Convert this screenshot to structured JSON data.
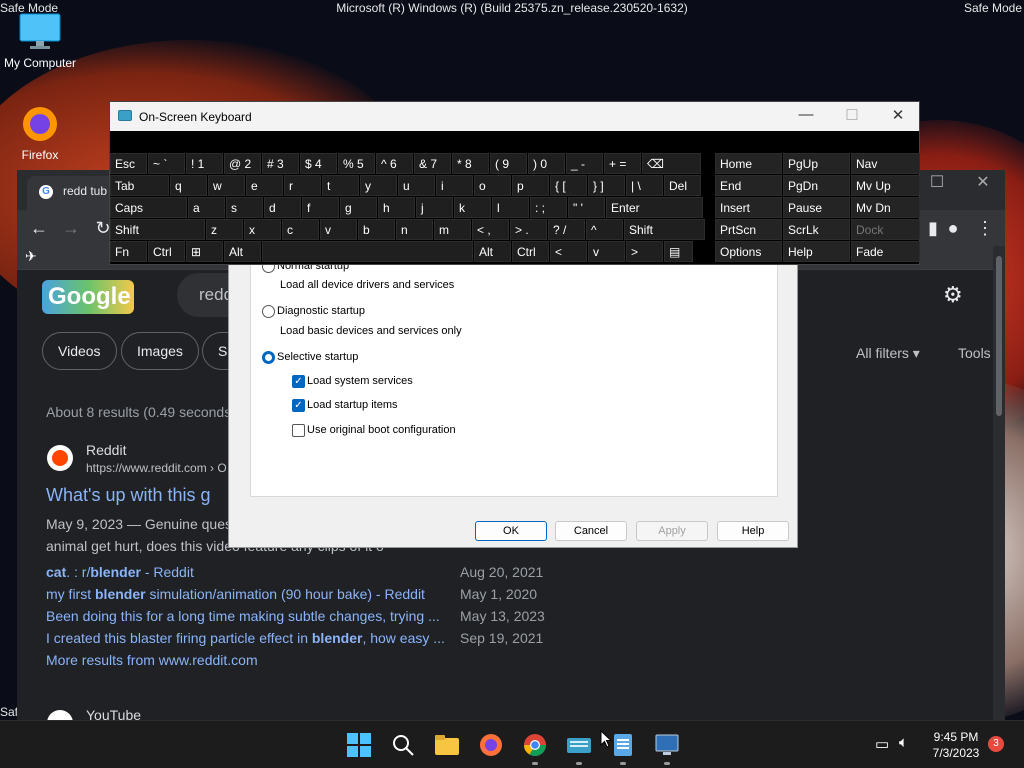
{
  "desktop": {
    "safe_mode_label": "Safe Mode",
    "title_bar": "Microsoft (R) Windows (R) (Build 25375.zn_release.230520-1632)",
    "icons": {
      "my_computer": "My Computer",
      "firefox": "Firefox"
    }
  },
  "browser": {
    "tab_title": "redd tub",
    "search_query": "redd",
    "chips": [
      "Videos",
      "Images",
      "S"
    ],
    "all_filters": "All filters",
    "tools": "Tools",
    "result_stats": "About 8 results (0.49 seconds",
    "result": {
      "site_name": "Reddit",
      "url": "https://www.reddit.com › O",
      "title": "What's up with this g",
      "snippet_line1": "May 9, 2023 — Genuine ques",
      "snippet_line2": "animal get hurt, does this video feature any clips of it o",
      "sublinks": [
        {
          "pre": "cat",
          "mid": ". : r/",
          "bold": "blender",
          "post": " - Reddit",
          "date": "Aug 20, 2021"
        },
        {
          "pre": "my first ",
          "mid": "",
          "bold": "blender",
          "post": " simulation/animation (90 hour bake) - Reddit",
          "date": "May 1, 2020"
        },
        {
          "pre": "Been doing this for a long time making subtle changes, trying ...",
          "mid": "",
          "bold": "",
          "post": "",
          "date": "May 13, 2023"
        },
        {
          "pre": "I created this blaster firing particle effect in ",
          "mid": "",
          "bold": "blender",
          "post": ", how easy ...",
          "date": "Sep 19, 2021"
        }
      ],
      "more_results": "More results from www.reddit.com"
    },
    "next_site": "YouTube"
  },
  "sysconfig": {
    "normal_startup": "Normal startup",
    "normal_desc": "Load all device drivers and services",
    "diagnostic_startup": "Diagnostic startup",
    "diagnostic_desc": "Load basic devices and services only",
    "selective_startup": "Selective startup",
    "load_system_services": "Load system services",
    "load_startup_items": "Load startup items",
    "use_original_boot": "Use original boot configuration",
    "buttons": {
      "ok": "OK",
      "cancel": "Cancel",
      "apply": "Apply",
      "help": "Help"
    }
  },
  "osk": {
    "title": "On-Screen Keyboard",
    "rows": [
      [
        "Esc",
        "~ `",
        "! 1",
        "@ 2",
        "# 3",
        "$ 4",
        "% 5",
        "^ 6",
        "& 7",
        "* 8",
        "( 9",
        ") 0",
        "_ -",
        "+ =",
        "⌫"
      ],
      [
        "Tab",
        "q",
        "w",
        "e",
        "r",
        "t",
        "y",
        "u",
        "i",
        "o",
        "p",
        "{ [",
        "} ]",
        "| \\",
        "Del"
      ],
      [
        "Caps",
        "a",
        "s",
        "d",
        "f",
        "g",
        "h",
        "j",
        "k",
        "l",
        ": ;",
        "\" '",
        "Enter"
      ],
      [
        "Shift",
        "z",
        "x",
        "c",
        "v",
        "b",
        "n",
        "m",
        "< ,",
        "> .",
        "? /",
        "^",
        "Shift"
      ],
      [
        "Fn",
        "Ctrl",
        "⊞",
        "Alt",
        "",
        "Alt",
        "Ctrl",
        "<",
        "v",
        ">",
        "▤"
      ]
    ],
    "nav_rows": [
      [
        "Home",
        "PgUp",
        "Nav"
      ],
      [
        "End",
        "PgDn",
        "Mv Up"
      ],
      [
        "Insert",
        "Pause",
        "Mv Dn"
      ],
      [
        "PrtScn",
        "ScrLk",
        "Dock"
      ],
      [
        "Options",
        "Help",
        "Fade"
      ]
    ]
  },
  "taskbar": {
    "time": "9:45 PM",
    "date": "7/3/2023",
    "notification_count": "3"
  }
}
